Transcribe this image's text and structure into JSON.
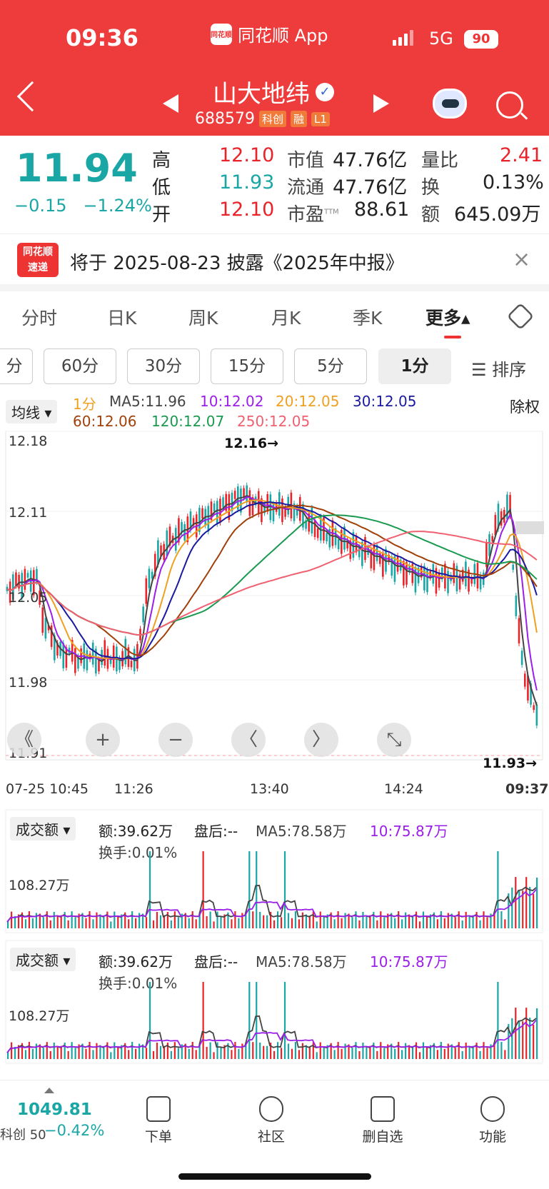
{
  "status": {
    "time": "09:36",
    "app": "同花顺 App",
    "app_icon_text": "同花顺",
    "network": "5G",
    "battery": "90"
  },
  "stock": {
    "name": "山大地纬",
    "code": "688579",
    "tags": [
      "科创",
      "融",
      "L1"
    ]
  },
  "quote": {
    "price": "11.94",
    "change": "−0.15",
    "change_pct": "−1.24%",
    "high_label": "高",
    "high": "12.10",
    "low_label": "低",
    "low": "11.93",
    "open_label": "开",
    "open": "12.10",
    "mcap_label": "市值",
    "mcap": "47.76亿",
    "float_label": "流通",
    "float": "47.76亿",
    "pe_label": "市盈",
    "pe_sup": "TTM",
    "pe": "88.61",
    "vr_label": "量比",
    "vr": "2.41",
    "turn_label": "换",
    "turn": "0.13%",
    "amt_label": "额",
    "amt": "645.09万"
  },
  "notice": {
    "logo_line1": "同花顺",
    "logo_line2": "速递",
    "text": "将于 2025-08-23 披露《2025年中报》",
    "close": "×"
  },
  "tabs": [
    "分时",
    "日K",
    "周K",
    "月K",
    "季K",
    "更多▴"
  ],
  "intervals": [
    "分",
    "60分",
    "30分",
    "15分",
    "5分",
    "1分"
  ],
  "sort_label": "☰ 排序",
  "ma": {
    "dropdown": "均线 ▾",
    "period": "1分",
    "ma5": "MA5:11.96",
    "ma10": "10:12.02",
    "ma20": "20:12.05",
    "ma30": "30:12.05",
    "ma60": "60:12.06",
    "ma120": "120:12.07",
    "ma250": "250:12.05",
    "adjust": "除权"
  },
  "chart": {
    "y_labels": [
      "12.18",
      "12.11",
      "12.05",
      "11.98",
      "11.91"
    ],
    "x_labels": [
      "07-25 10:45",
      "11:26",
      "13:40",
      "14:24",
      "09:37"
    ],
    "high_mark": "12.16→",
    "low_mark": "11.93→",
    "controls": [
      "《",
      "+",
      "−",
      "〈",
      "〉",
      "⤡"
    ]
  },
  "volume_panels": [
    {
      "dropdown": "成交额 ▾",
      "amount": "额:39.62万",
      "after": "盘后:--",
      "ma5": "MA5:78.58万",
      "ma10": "10:75.87万",
      "turnover": "换手:0.01%",
      "y_label": "108.27万"
    },
    {
      "dropdown": "成交额 ▾",
      "amount": "额:39.62万",
      "after": "盘后:--",
      "ma5": "MA5:78.58万",
      "ma10": "10:75.87万",
      "turnover": "换手:0.01%",
      "y_label": "108.27万"
    }
  ],
  "bottom": {
    "index_value": "1049.81",
    "index_name": "科创 50",
    "index_change": "−0.42%",
    "nav": [
      "下单",
      "社区",
      "删自选",
      "功能"
    ]
  },
  "colors": {
    "header": "#ee3b3b",
    "down": "#1ba6a6",
    "up": "#e8242a"
  }
}
